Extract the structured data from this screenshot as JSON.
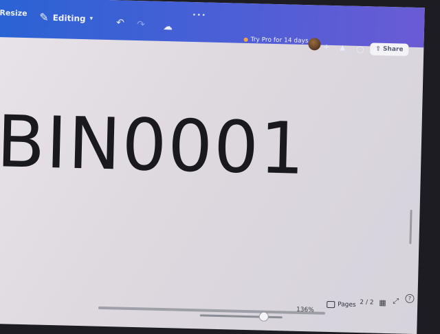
{
  "topbar": {
    "resize_label": "Resize",
    "mode_label": "Editing",
    "promo_label": "Try Pro for 14 days",
    "share_label": "Share"
  },
  "canvas": {
    "text": "BIN0001"
  },
  "footer": {
    "zoom": "136%",
    "pages_label": "Pages",
    "page_count": "2 / 2"
  }
}
